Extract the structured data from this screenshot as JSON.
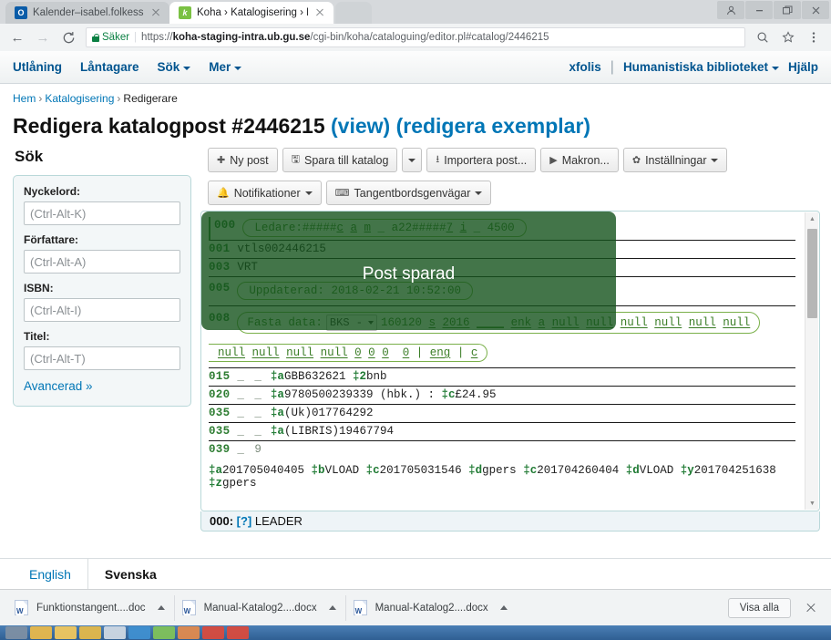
{
  "browser": {
    "tabs": [
      {
        "title": "Kalender–isabel.folkesso",
        "favicon": "outlook-icon",
        "favicon_letter": "O",
        "active": false
      },
      {
        "title": "Koha › Katalogisering › R",
        "favicon": "koha-icon",
        "favicon_letter": "k",
        "active": true
      }
    ],
    "window_buttons": [
      "profile-icon",
      "minimize-icon",
      "maximize-icon",
      "close-icon"
    ],
    "nav": {
      "back": "←",
      "forward": "→",
      "reload": "⟳"
    },
    "omnibox": {
      "security_label": "Säker",
      "scheme": "https://",
      "host": "koha-staging-intra.ub.gu.se",
      "path": "/cgi-bin/koha/cataloguing/editor.pl#catalog/2446215"
    },
    "omnibox_actions": [
      "zoom-icon",
      "bookmark-star-icon",
      "chrome-menu-icon"
    ]
  },
  "koha": {
    "navbar": {
      "left_items": [
        {
          "label": "Utlåning",
          "has_caret": false
        },
        {
          "label": "Låntagare",
          "has_caret": false
        },
        {
          "label": "Sök",
          "has_caret": true
        },
        {
          "label": "Mer",
          "has_caret": true
        }
      ],
      "user": "xfolis",
      "divider": "|",
      "library": "Humanistiska biblioteket",
      "help": "Hjälp"
    },
    "breadcrumb": {
      "home": "Hem",
      "sep": "›",
      "section": "Katalogisering",
      "current": "Redigerare"
    },
    "page_title": {
      "main": "Redigera katalogpost #2446215",
      "view_link": "(view)",
      "edit_items_link": "(redigera exemplar)"
    },
    "sidebar": {
      "heading": "Sök",
      "fields": [
        {
          "label": "Nyckelord:",
          "placeholder": "(Ctrl-Alt-K)",
          "value": ""
        },
        {
          "label": "Författare:",
          "placeholder": "(Ctrl-Alt-A)",
          "value": ""
        },
        {
          "label": "ISBN:",
          "placeholder": "(Ctrl-Alt-I)",
          "value": ""
        },
        {
          "label": "Titel:",
          "placeholder": "(Ctrl-Alt-T)",
          "value": ""
        }
      ],
      "advanced_link": "Avancerad »"
    },
    "toolbar": {
      "row1": [
        {
          "label": "Ny post",
          "icon": "plus-icon",
          "caret": false
        },
        {
          "label": "Spara till katalog",
          "icon": "save-icon",
          "caret": false
        },
        {
          "label": "",
          "icon": "",
          "caret": true
        },
        {
          "label": "Importera post...",
          "icon": "import-icon",
          "caret": false
        },
        {
          "label": "Makron...",
          "icon": "play-icon",
          "caret": false
        },
        {
          "label": "Inställningar",
          "icon": "gear-icon",
          "caret": true
        }
      ],
      "row2": [
        {
          "label": "Notifikationer",
          "icon": "bell-icon",
          "caret": true
        },
        {
          "label": "Tangentbordsgenvägar",
          "icon": "keyboard-icon",
          "caret": true
        }
      ]
    },
    "saved_overlay": {
      "text": "Post sparad"
    },
    "marc": {
      "leader": {
        "tag": "000",
        "prefix": "Ledare:",
        "segments": [
          "#####",
          "c",
          "a",
          "m",
          "_",
          "a22#####",
          "7",
          "i",
          "_",
          "4500"
        ]
      },
      "lines": [
        {
          "tag": "001",
          "ind": "",
          "content": "vtls002446215"
        },
        {
          "tag": "003",
          "ind": "",
          "content": "VRT"
        }
      ],
      "f005": {
        "tag": "005",
        "label": "Uppdaterad:",
        "value": "2018-02-21 10:52:00"
      },
      "f008": {
        "tag": "008",
        "label": "Fasta data:",
        "select_value": "BKS -",
        "row1": [
          "160120",
          "s",
          "2016",
          "____",
          "enk",
          "a",
          "null",
          "null",
          "null",
          "null",
          "null",
          "null"
        ],
        "row2": [
          "null",
          "null",
          "null",
          "null",
          "0",
          "0",
          "0",
          "0",
          "|",
          "eng",
          "|",
          "c"
        ]
      },
      "fields": [
        {
          "tag": "015",
          "ind": "_ _",
          "subfields": [
            {
              "code": "‡a",
              "text": "GBB632621"
            },
            {
              "code": "‡2",
              "text": "bnb"
            }
          ]
        },
        {
          "tag": "020",
          "ind": "_ _",
          "subfields": [
            {
              "code": "‡a",
              "text": "9780500239339 (hbk.)  :"
            },
            {
              "code": "‡c",
              "text": "£24.95"
            }
          ]
        },
        {
          "tag": "035",
          "ind": "_ _",
          "subfields": [
            {
              "code": "‡a",
              "text": "(Uk)017764292"
            }
          ]
        },
        {
          "tag": "035",
          "ind": "_ _",
          "subfields": [
            {
              "code": "‡a",
              "text": "(LIBRIS)19467794"
            }
          ]
        }
      ],
      "f039": {
        "tag": "039",
        "ind": "_ 9",
        "subfields": [
          {
            "code": "‡a",
            "text": "201705040405"
          },
          {
            "code": "‡b",
            "text": "VLOAD"
          },
          {
            "code": "‡c",
            "text": "201705031546"
          },
          {
            "code": "‡d",
            "text": "gpers"
          },
          {
            "code": "‡c",
            "text": "201704260404"
          },
          {
            "code": "‡d",
            "text": "VLOAD"
          },
          {
            "code": "‡y",
            "text": "201704251638"
          },
          {
            "code": "‡z",
            "text": "gpers"
          }
        ]
      },
      "status": {
        "tag": "000:",
        "help": "[?]",
        "name": "LEADER"
      }
    },
    "languages": [
      {
        "label": "English",
        "active": false
      },
      {
        "label": "Svenska",
        "active": true
      }
    ]
  },
  "downloads": {
    "items": [
      {
        "name": "Funktionstangent....doc",
        "icon": "word-doc-icon"
      },
      {
        "name": "Manual-Katalog2....docx",
        "icon": "word-doc-icon"
      },
      {
        "name": "Manual-Katalog2....docx",
        "icon": "word-doc-icon"
      }
    ],
    "show_all": "Visa alla",
    "close": "close-icon"
  },
  "colors": {
    "koha_link": "#0076b6",
    "koha_nav_text": "#00548f",
    "marc_tag_green": "#2e7d32",
    "saved_overlay_green": "#14521b",
    "secure_green": "#0b8043",
    "taskbar_blue": "#2f5f93"
  }
}
